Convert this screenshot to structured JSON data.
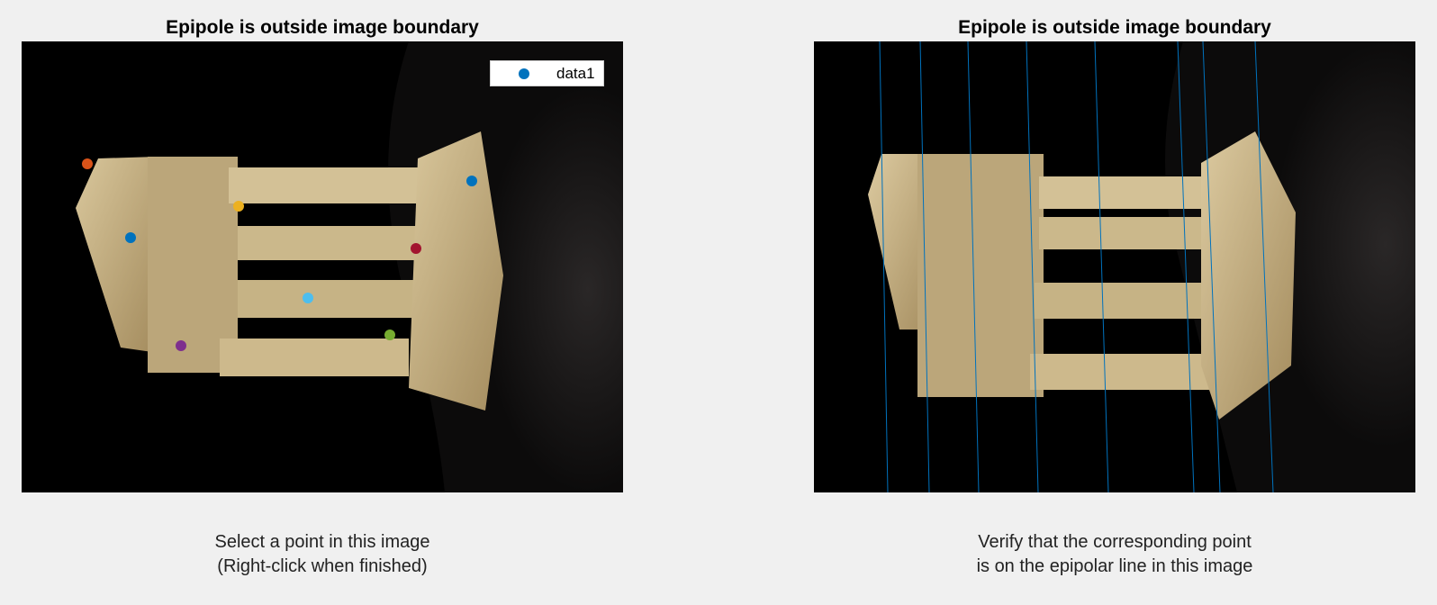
{
  "left": {
    "title": "Epipole is outside image boundary",
    "caption": [
      "Select a point in this image",
      "(Right-click when finished)"
    ],
    "legend": {
      "label": "data1",
      "marker_color": "#0072bd"
    },
    "points": [
      {
        "name": "point-orange",
        "color": "#d95319"
      },
      {
        "name": "point-blue",
        "color": "#0072bd"
      },
      {
        "name": "point-yellow",
        "color": "#edb120"
      },
      {
        "name": "point-blue-left",
        "color": "#0072bd"
      },
      {
        "name": "point-red",
        "color": "#a2142f"
      },
      {
        "name": "point-cyan",
        "color": "#4dbeee"
      },
      {
        "name": "point-green",
        "color": "#77ac30"
      },
      {
        "name": "point-purple",
        "color": "#7e2f8e"
      }
    ]
  },
  "right": {
    "title": "Epipole is outside image boundary",
    "caption": [
      "Verify that the corresponding point",
      "is on the epipolar line in this image"
    ],
    "line_color": "#0072bd",
    "epipolar_line_count": 8
  }
}
